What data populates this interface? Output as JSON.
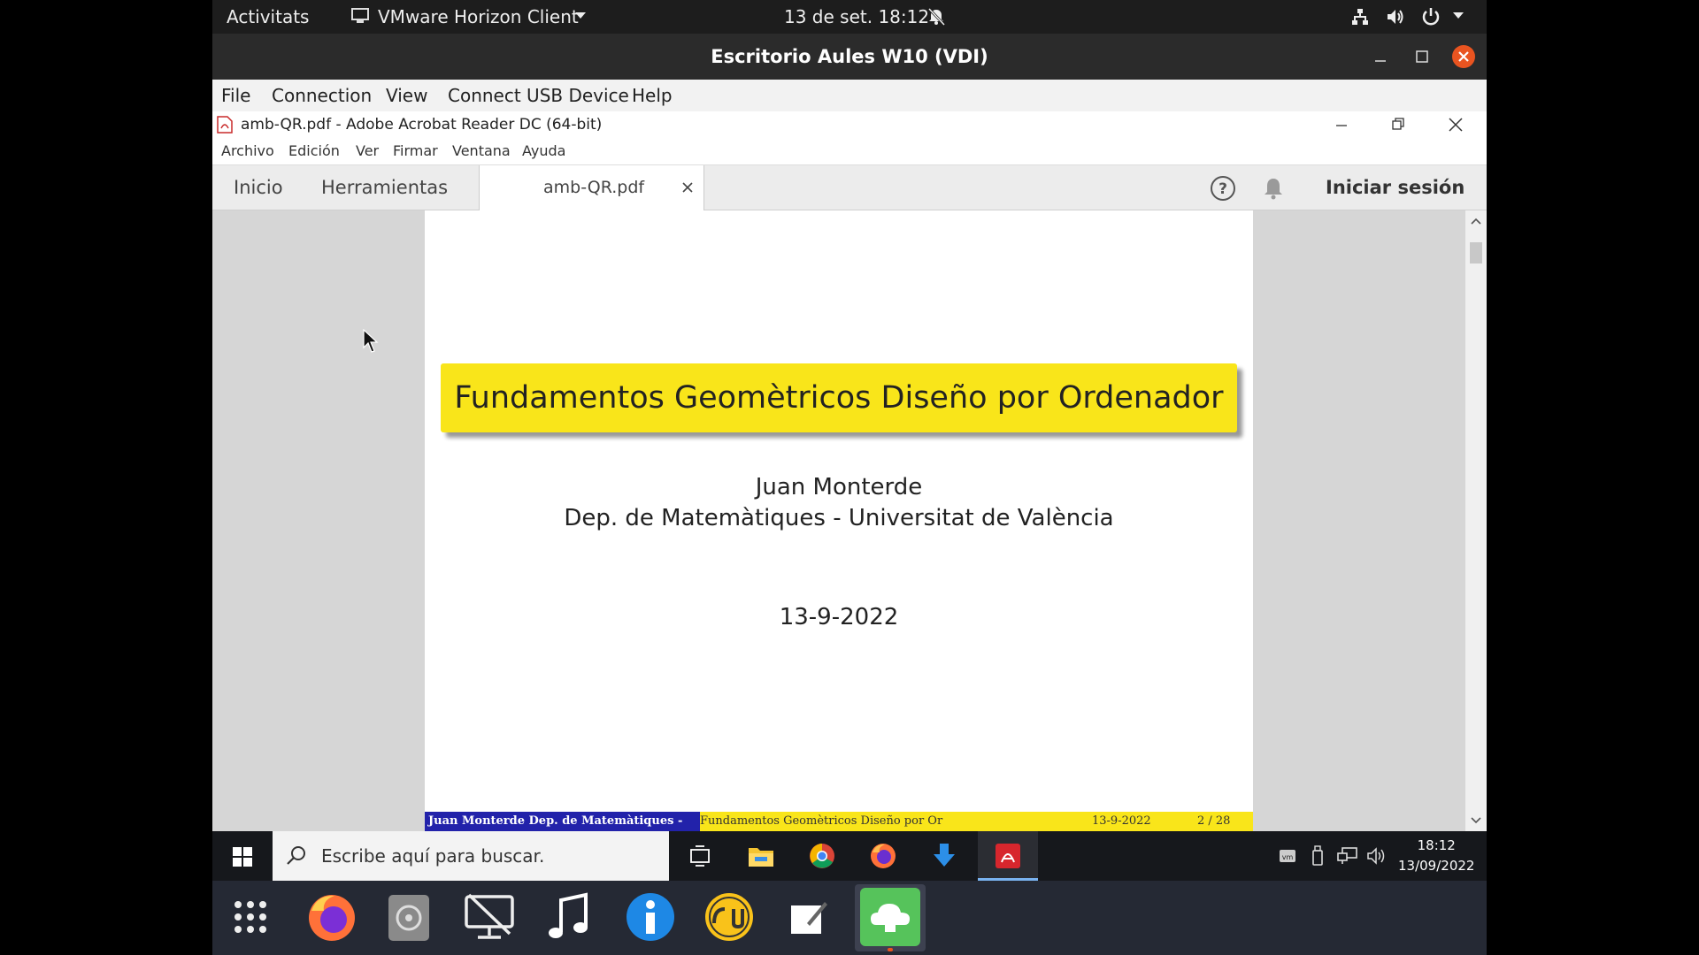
{
  "topbar": {
    "activities": "Activitats",
    "app_name": "VMware Horizon Client",
    "clock": "13 de set.  18:12"
  },
  "horizon": {
    "window_title": "Escritorio Aules W10 (VDI)",
    "menu": [
      "File",
      "Connection",
      "View",
      "Connect USB Device",
      "Help"
    ]
  },
  "acrobat": {
    "window_title": "amb-QR.pdf - Adobe Acrobat Reader DC (64-bit)",
    "menu": [
      "Archivo",
      "Edición",
      "Ver",
      "Firmar",
      "Ventana",
      "Ayuda"
    ],
    "tabs": {
      "home": "Inicio",
      "tools": "Herramientas",
      "document": "amb-QR.pdf"
    },
    "sign_in": "Iniciar sesión"
  },
  "slide": {
    "title": "Fundamentos Geomètricos Diseño por Ordenador",
    "author": "Juan Monterde",
    "affiliation": "Dep. de Matemàtiques - Universitat de València",
    "date": "13-9-2022",
    "footer_left": "Juan Monterde Dep. de Matemàtiques -",
    "footer_title": "Fundamentos Geomètricos Diseño por Or",
    "footer_date": "13-9-2022",
    "footer_page": "2 / 28"
  },
  "windows_taskbar": {
    "search_placeholder": "Escribe aquí para buscar.",
    "time": "18:12",
    "date": "13/09/2022"
  },
  "colors": {
    "slide_yellow": "#f9e51a",
    "slide_blue": "#2222aa",
    "horizon_close": "#e95420"
  }
}
